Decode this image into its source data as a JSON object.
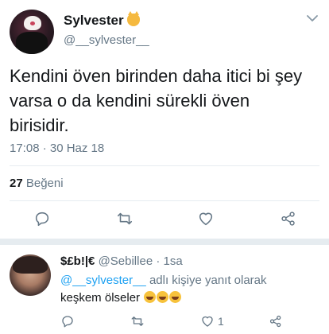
{
  "tweet": {
    "display_name": "Sylvester",
    "name_emoji": "cat-face-emoji",
    "handle": "@__sylvester__",
    "text": "Kendini öven birinden daha itici bi şey varsa o da kendini sürekli öven birisidir.",
    "timestamp": "17:08 · 30 Haz 18",
    "likes_count": "27",
    "likes_label": "Beğeni",
    "actions": [
      "reply-icon",
      "retweet-icon",
      "like-icon",
      "share-icon"
    ]
  },
  "reply": {
    "display_name": "$£b!|€",
    "handle": "@Sebillee",
    "time": "· 1sa",
    "mention": "@__sylvester__",
    "reply_suffix": "adlı kişiye yanıt olarak",
    "text": "keşkem ölseler",
    "emojis": [
      "tears-of-joy-emoji",
      "tears-of-joy-emoji",
      "tears-of-joy-emoji"
    ],
    "like_count": "1"
  },
  "colors": {
    "link": "#1da1f2",
    "secondary": "#657786",
    "separator": "#e6ecf0"
  }
}
